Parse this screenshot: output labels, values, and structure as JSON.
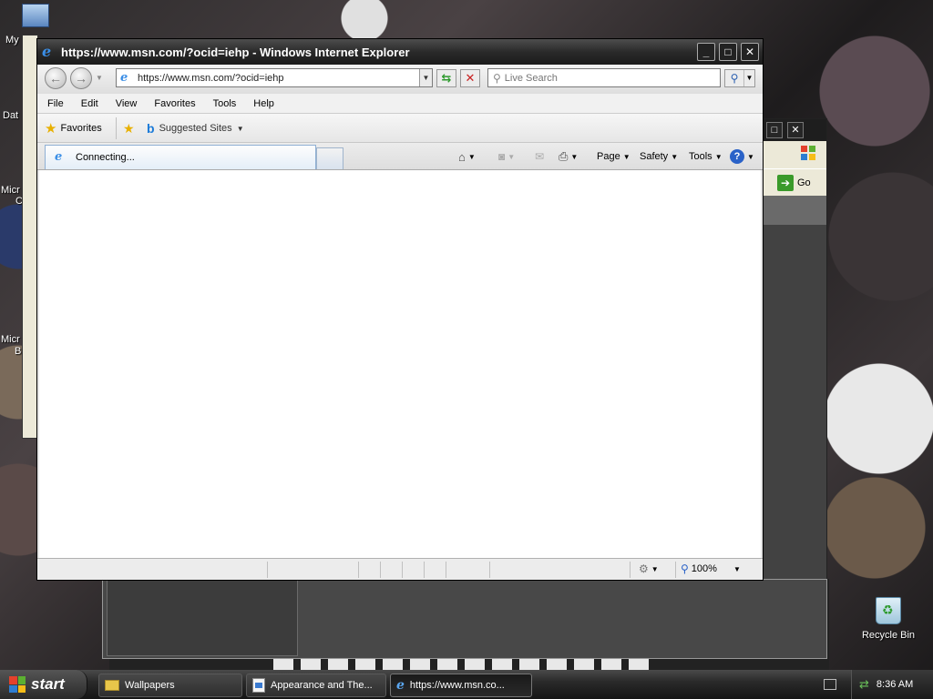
{
  "desktop": {
    "icons": [
      {
        "label": "My Di",
        "name": "my-documents"
      },
      {
        "label": "Dat",
        "name": "data"
      },
      {
        "label": "Micr",
        "name": "micro-1"
      },
      {
        "label": "C",
        "name": "c"
      },
      {
        "label": "Micr",
        "name": "micro-2"
      },
      {
        "label": "B",
        "name": "b"
      }
    ],
    "recycle_bin_label": "Recycle Bin"
  },
  "background_window": {
    "go_label": "Go"
  },
  "ie": {
    "title": "https://www.msn.com/?ocid=iehp - Windows Internet Explorer",
    "controls": {
      "minimize": "_",
      "maximize": "□",
      "close": "✕"
    },
    "address": "https://www.msn.com/?ocid=iehp",
    "search_placeholder": "Live Search",
    "menu": [
      "File",
      "Edit",
      "View",
      "Favorites",
      "Tools",
      "Help"
    ],
    "favorites_label": "Favorites",
    "suggested_sites_label": "Suggested Sites",
    "tab_label": "Connecting...",
    "commands": {
      "page": "Page",
      "safety": "Safety",
      "tools": "Tools"
    },
    "zoom": "100%"
  },
  "taskbar": {
    "start_label": "start",
    "tasks": [
      {
        "label": "Wallpapers",
        "icon": "folder-icon"
      },
      {
        "label": "Appearance and The...",
        "icon": "control-panel-icon"
      },
      {
        "label": "https://www.msn.co...",
        "icon": "ie-icon",
        "active": true
      }
    ],
    "clock": "8:36 AM"
  }
}
